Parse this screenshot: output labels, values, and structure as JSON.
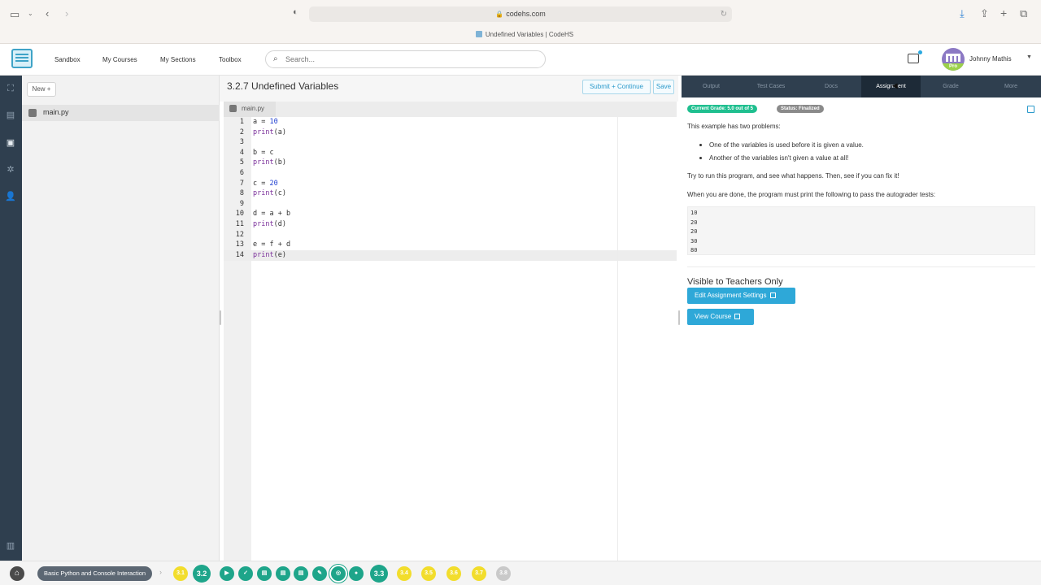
{
  "browser": {
    "url": "codehs.com",
    "tab_title": "Undefined Variables | CodeHS"
  },
  "header": {
    "nav": [
      "Sandbox",
      "My Courses",
      "My Sections",
      "Toolbox"
    ],
    "search_placeholder": "Search...",
    "user_name": "Johnny Mathis",
    "avatar_badge": "Pro"
  },
  "files": {
    "new_label": "New +",
    "items": [
      "main.py"
    ]
  },
  "editor": {
    "title": "3.2.7 Undefined Variables",
    "submit_label": "Submit + Continue",
    "save_label": "Save",
    "open_tab": "main.py",
    "line_numbers": [
      "1",
      "2",
      "3",
      "4",
      "5",
      "6",
      "7",
      "8",
      "9",
      "10",
      "11",
      "12",
      "13",
      "14"
    ],
    "lines": [
      [
        {
          "t": "a = ",
          "c": ""
        },
        {
          "t": "10",
          "c": "num"
        }
      ],
      [
        {
          "t": "print",
          "c": "kw"
        },
        {
          "t": "(a)",
          "c": ""
        }
      ],
      [],
      [
        {
          "t": "b = c",
          "c": ""
        }
      ],
      [
        {
          "t": "print",
          "c": "kw"
        },
        {
          "t": "(b)",
          "c": ""
        }
      ],
      [],
      [
        {
          "t": "c = ",
          "c": ""
        },
        {
          "t": "20",
          "c": "num"
        }
      ],
      [
        {
          "t": "print",
          "c": "kw"
        },
        {
          "t": "(c)",
          "c": ""
        }
      ],
      [],
      [
        {
          "t": "d = a + b",
          "c": ""
        }
      ],
      [
        {
          "t": "print",
          "c": "kw"
        },
        {
          "t": "(d)",
          "c": ""
        }
      ],
      [],
      [
        {
          "t": "e = f + d",
          "c": ""
        }
      ],
      [
        {
          "t": "print",
          "c": "kw"
        },
        {
          "t": "(e)",
          "c": ""
        }
      ]
    ]
  },
  "right_panel": {
    "tabs": [
      "Output",
      "Test Cases",
      "Docs",
      "Assignment",
      "Grade",
      "More"
    ],
    "active_tab": "Assignment",
    "grade_badge": "Current Grade: 5.0 out of 5",
    "status_badge": "Status: Finalized",
    "intro": "This example has two problems:",
    "bullets": [
      "One of the variables is used before it is given a value.",
      "Another of the variables isn't given a value at all!"
    ],
    "try_text": "Try to run this program, and see what happens. Then, see if you can fix it!",
    "done_text": "When you are done, the program must print the following to pass the autograder tests:",
    "expected_output": [
      "10",
      "20",
      "20",
      "30",
      "80"
    ],
    "teacher_title": "Visible to Teachers Only",
    "edit_settings_label": "Edit Assignment Settings",
    "view_course_label": "View Course"
  },
  "bottom_bar": {
    "course_name": "Basic Python and Console Interaction",
    "units": [
      "3.1",
      "3.2",
      "3.3",
      "3.4",
      "3.5",
      "3.6",
      "3.7",
      "3.8"
    ]
  },
  "colors": {
    "accent_blue": "#2ea8d8",
    "grade_green": "#1fbf8f",
    "status_gray": "#8a8a8a",
    "unit_yellow": "#f2dd2c",
    "unit_teal": "#1ea58a",
    "rail_dark": "#2f3f4f"
  }
}
